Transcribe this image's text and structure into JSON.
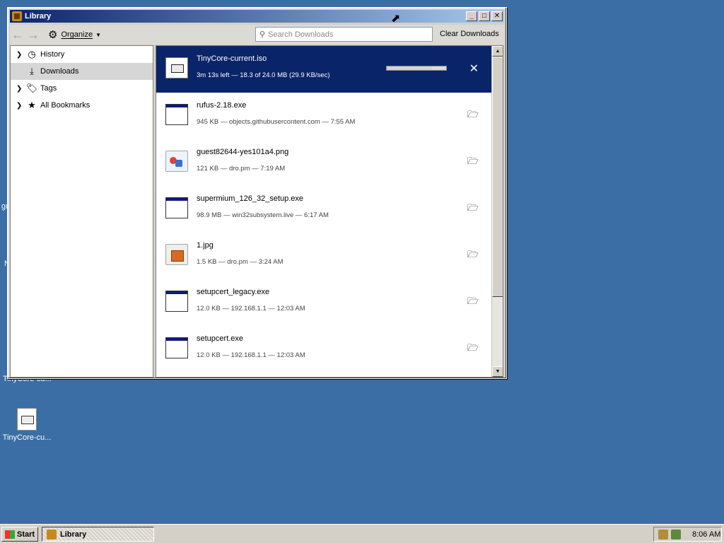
{
  "window": {
    "title": "Library",
    "buttons": {
      "minimize": "_",
      "maximize": "□",
      "close": "✕"
    }
  },
  "toolbar": {
    "back_icon": "arrow-left-icon",
    "forward_icon": "arrow-right-icon",
    "organize_label": "Organize",
    "search_placeholder": "Search Downloads",
    "clear_label": "Clear Downloads"
  },
  "sidebar": {
    "items": [
      {
        "label": "History",
        "icon": "clock-icon",
        "expandable": true,
        "selected": false
      },
      {
        "label": "Downloads",
        "icon": "download-icon",
        "expandable": false,
        "selected": true
      },
      {
        "label": "Tags",
        "icon": "tag-icon",
        "expandable": true,
        "selected": false
      },
      {
        "label": "All Bookmarks",
        "icon": "star-icon",
        "expandable": true,
        "selected": false
      }
    ]
  },
  "downloads": [
    {
      "name": "TinyCore-current.iso",
      "meta": "3m 13s left — 18.3 of 24.0 MB (29.9 KB/sec)",
      "type": "iso",
      "active": true,
      "progress": 0.76,
      "action": "✕"
    },
    {
      "name": "rufus-2.18.exe",
      "meta": "945 KB — objects.githubusercontent.com — 7:55 AM",
      "type": "exe",
      "active": false,
      "action": "folder"
    },
    {
      "name": "guest82644-yes101a4.png",
      "meta": "121 KB — dro.pm — 7:19 AM",
      "type": "png",
      "active": false,
      "action": "folder"
    },
    {
      "name": "supermium_126_32_setup.exe",
      "meta": "98.9 MB — win32subsystem.live — 6:17 AM",
      "type": "exe",
      "active": false,
      "action": "folder"
    },
    {
      "name": "1.jpg",
      "meta": "1.5 KB — dro.pm — 3:24 AM",
      "type": "jpg",
      "active": false,
      "action": "folder"
    },
    {
      "name": "setupcert_legacy.exe",
      "meta": "12.0 KB — 192.168.1.1 — 12:03 AM",
      "type": "exe",
      "active": false,
      "action": "folder"
    },
    {
      "name": "setupcert.exe",
      "meta": "12.0 KB — 192.168.1.1 — 12:03 AM",
      "type": "exe",
      "active": false,
      "action": "folder"
    }
  ],
  "desktop": {
    "fragment_1": "gı",
    "fragment_2": "N",
    "icon_label_partial": "TinyCore-cu...",
    "icon_label": "TinyCore-cu..."
  },
  "taskbar": {
    "start_label": "Start",
    "task_label": "Library",
    "clock": "8:06 AM"
  },
  "colors": {
    "desktop": "#3a6ea5",
    "titlebar_start": "#0a246a",
    "titlebar_end": "#a6caf0",
    "active_row": "#0a246a"
  }
}
